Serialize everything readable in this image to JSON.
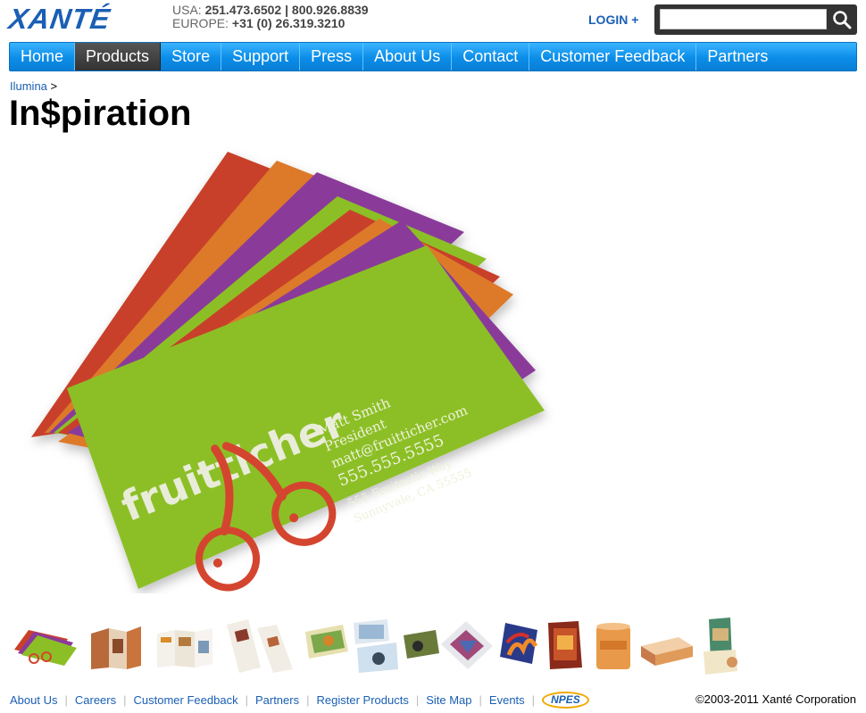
{
  "header": {
    "logo": "XANTÉ",
    "phone_usa_label": "USA:",
    "phone_usa": "251.473.6502 | 800.926.8839",
    "phone_europe_label": "EUROPE:",
    "phone_europe": "+31 (0) 26.319.3210",
    "login_label": "LOGIN +",
    "search_placeholder": ""
  },
  "nav": {
    "items": [
      {
        "label": "Home"
      },
      {
        "label": "Products"
      },
      {
        "label": "Store"
      },
      {
        "label": "Support"
      },
      {
        "label": "Press"
      },
      {
        "label": "About Us"
      },
      {
        "label": "Contact"
      },
      {
        "label": "Customer Feedback"
      },
      {
        "label": "Partners"
      }
    ],
    "active_index": 1
  },
  "breadcrumb": {
    "link": "Ilumina",
    "sep": ">"
  },
  "page_title": "In$piration",
  "hero_card": {
    "brand": "fruitticher",
    "name": "Matt Smith",
    "title": "President",
    "email": "matt@fruitticher.com",
    "phone": "555.555.5555",
    "address1": "555 Fruitastic Way",
    "address2": "Sunnyvale, CA 55555"
  },
  "thumbnails": [
    "business-cards",
    "folded-brochure",
    "trifold-brochure",
    "door-hangers",
    "postcards",
    "photo-postcards",
    "motocross-cards",
    "cd-sleeve",
    "flame-cards",
    "book-cover",
    "cylinder-package",
    "box-package",
    "tall-box-package"
  ],
  "footer": {
    "links": [
      "About Us",
      "Careers",
      "Customer Feedback",
      "Partners",
      "Register Products",
      "Site Map",
      "Events"
    ],
    "npes": "NPES",
    "copyright": "©2003-2011 Xanté Corporation"
  },
  "colors": {
    "brand_blue": "#1a5fb4",
    "nav_blue": "#0b8de8",
    "card_green": "#8cbf26",
    "cherry_red": "#d4452f"
  }
}
